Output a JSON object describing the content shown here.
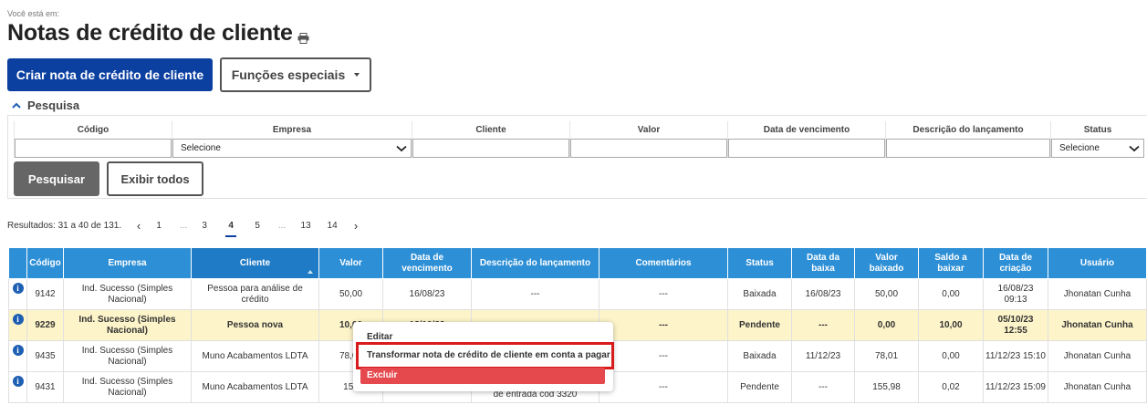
{
  "breadcrumb": "Você está em:",
  "page_title": "Notas de crédito de cliente",
  "toolbar": {
    "create_label": "Criar nota de crédito de cliente",
    "special_label": "Funções especiais"
  },
  "search": {
    "section_label": "Pesquisa",
    "filters": [
      {
        "label": "Código",
        "value": ""
      },
      {
        "label": "Empresa",
        "value": "Selecione",
        "type": "select"
      },
      {
        "label": "Cliente",
        "value": ""
      },
      {
        "label": "Valor",
        "value": ""
      },
      {
        "label": "Data de vencimento",
        "value": ""
      },
      {
        "label": "Descrição do lançamento",
        "value": ""
      },
      {
        "label": "Status",
        "value": "Selecione",
        "type": "select"
      }
    ],
    "search_label": "Pesquisar",
    "show_all_label": "Exibir todos"
  },
  "pagination": {
    "results_text": "Resultados: 31 a 40 de 131.",
    "prev": "‹",
    "next": "›",
    "pages": [
      "1",
      "...",
      "3",
      "4",
      "5",
      "...",
      "13",
      "14"
    ],
    "current": "4"
  },
  "table": {
    "headers": [
      "",
      "Código",
      "Empresa",
      "Cliente",
      "Valor",
      "Data de vencimento",
      "Descrição do lançamento",
      "Comentários",
      "Status",
      "Data da baixa",
      "Valor baixado",
      "Saldo a baixar",
      "Data de criação",
      "Usuário"
    ],
    "rows": [
      [
        "i",
        "9142",
        "Ind. Sucesso (Simples Nacional)",
        "Pessoa para análise de crédito",
        "50,00",
        "16/08/23",
        "---",
        "---",
        "Baixada",
        "16/08/23",
        "50,00",
        "0,00",
        "16/08/23 09:13",
        "Jhonatan Cunha"
      ],
      [
        "i",
        "9229",
        "Ind. Sucesso (Simples Nacional)",
        "Pessoa nova",
        "10,00",
        "18/10/23",
        "---",
        "---",
        "Pendente",
        "---",
        "0,00",
        "10,00",
        "05/10/23 12:55",
        "Jhonatan Cunha"
      ],
      [
        "i",
        "9435",
        "Ind. Sucesso (Simples Nacional)",
        "Muno Acabamentos LDTA",
        "78,01",
        "",
        "---",
        "---",
        "Baixada",
        "11/12/23",
        "78,01",
        "0,00",
        "11/12/23 15:10",
        "Jhonatan Cunha"
      ],
      [
        "i",
        "9431",
        "Ind. Sucesso (Simples Nacional)",
        "Muno Acabamentos LDTA",
        "156",
        "",
        "de entrada cód 3320",
        "---",
        "Pendente",
        "---",
        "155,98",
        "0,02",
        "11/12/23 15:09",
        "Jhonatan Cunha"
      ]
    ]
  },
  "context_menu": {
    "items": [
      "Editar",
      "Transformar nota de crédito de cliente em conta a pagar",
      "Excluir"
    ]
  },
  "colors": {
    "primary": "#0b3fa0",
    "table_header": "#2d8fd6",
    "highlight_row": "#fdf4c9",
    "danger": "#e5484d",
    "focus_outline": "#d81b1b"
  }
}
